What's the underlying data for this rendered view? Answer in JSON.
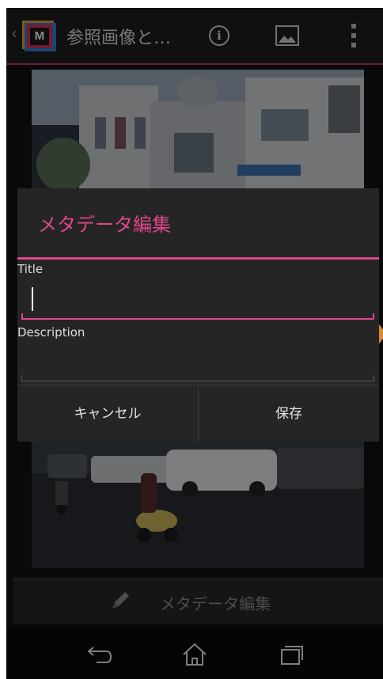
{
  "action_bar": {
    "title": "参照画像と…",
    "icons": [
      "up-chevron-icon",
      "app-icon",
      "info-icon",
      "image-icon",
      "overflow-menu-icon"
    ],
    "app_icon_letter": "M",
    "info_glyph": "i"
  },
  "bottom_action": {
    "label": "メタデータ編集",
    "icon": "pencil-icon"
  },
  "dialog": {
    "title": "メタデータ編集",
    "fields": [
      {
        "label": "Title",
        "value": ""
      },
      {
        "label": "Description",
        "value": ""
      }
    ],
    "cancel_label": "キャンセル",
    "save_label": "保存"
  },
  "nav_bar": {
    "icons": [
      "back-icon",
      "home-icon",
      "recents-icon"
    ]
  },
  "colors": {
    "accent": "#e0468a",
    "background": "#121212",
    "dialog": "#252525"
  }
}
